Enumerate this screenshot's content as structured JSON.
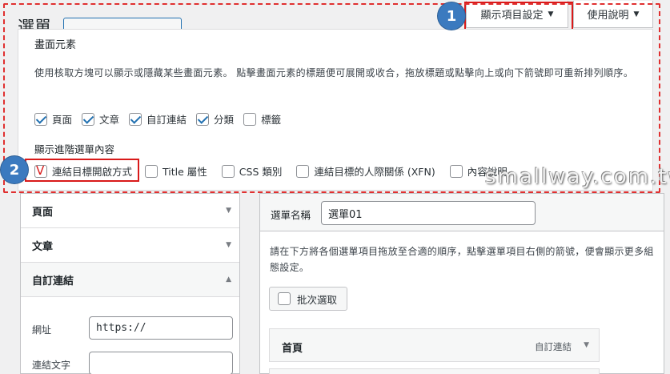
{
  "page": {
    "title": "選單"
  },
  "screen_meta": {
    "screen_options_label": "顯示項目設定",
    "help_label": "使用說明"
  },
  "screen_options": {
    "heading": "畫面元素",
    "description": "使用核取方塊可以顯示或隱藏某些畫面元素。 點擊畫面元素的標題便可展開或收合，拖放標題或點擊向上或向下箭號即可重新排列順序。",
    "boxes": [
      {
        "label": "頁面",
        "checked": true
      },
      {
        "label": "文章",
        "checked": true
      },
      {
        "label": "自訂連結",
        "checked": true
      },
      {
        "label": "分類",
        "checked": true
      },
      {
        "label": "標籤",
        "checked": false
      }
    ],
    "advanced_heading": "顯示進階選單內容",
    "advanced": [
      {
        "label": "連結目標開啟方式",
        "mark": "V"
      },
      {
        "label": "Title 屬性"
      },
      {
        "label": "CSS 類別"
      },
      {
        "label": "連結目標的人際關係 (XFN)"
      },
      {
        "label": "內容說明"
      }
    ]
  },
  "annotations": {
    "step1": "1",
    "step2": "2",
    "watermark": "smallway.com.tw"
  },
  "accordion": {
    "items": [
      {
        "label": "頁面"
      },
      {
        "label": "文章"
      },
      {
        "label": "自訂連結"
      }
    ],
    "custom_link": {
      "url_label": "網址",
      "url_value": "https://",
      "text_label": "連結文字"
    }
  },
  "menu": {
    "name_label": "選單名稱",
    "name_value": "選單01",
    "instructions": "請在下方將各個選單項目拖放至合適的順序，點擊選單項目右側的箭號，便會顯示更多組態設定。",
    "bulk_select": "批次選取",
    "items": [
      {
        "title": "首頁",
        "type": "自訂連結"
      }
    ]
  }
}
